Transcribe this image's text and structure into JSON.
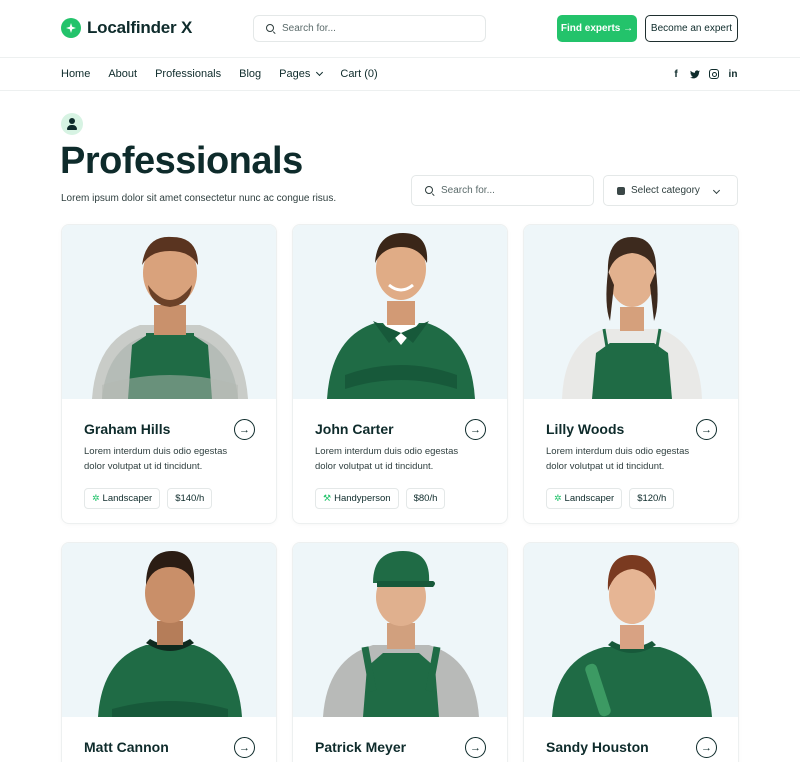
{
  "brand": {
    "name": "Localfinder X"
  },
  "header": {
    "search_placeholder": "Search for...",
    "find_button": "Find experts →",
    "become_button": "Become an expert"
  },
  "nav": {
    "items": [
      "Home",
      "About",
      "Professionals",
      "Blog",
      "Pages",
      "Cart (0)"
    ],
    "social_icons": [
      "facebook-icon",
      "twitter-icon",
      "instagram-icon",
      "linkedin-icon"
    ]
  },
  "hero": {
    "title": "Professionals",
    "subtitle": "Lorem ipsum dolor sit amet consectetur nunc ac congue risus.",
    "search_placeholder": "Search for...",
    "category_label": "Select category"
  },
  "colors": {
    "accent": "#23c36b",
    "text": "#0e2b2b",
    "uniform": "#1f6b45"
  },
  "professionals": [
    {
      "name": "Graham Hills",
      "desc": "Lorem interdum duis odio egestas dolor volutpat ut id tincidunt.",
      "category": "Landscaper",
      "rate": "$140/h"
    },
    {
      "name": "John Carter",
      "desc": "Lorem interdum duis odio egestas dolor volutpat ut id tincidunt.",
      "category": "Handyperson",
      "rate": "$80/h"
    },
    {
      "name": "Lilly Woods",
      "desc": "Lorem interdum duis odio egestas dolor volutpat ut id tincidunt.",
      "category": "Landscaper",
      "rate": "$120/h"
    },
    {
      "name": "Matt Cannon"
    },
    {
      "name": "Patrick Meyer"
    },
    {
      "name": "Sandy Houston"
    }
  ]
}
